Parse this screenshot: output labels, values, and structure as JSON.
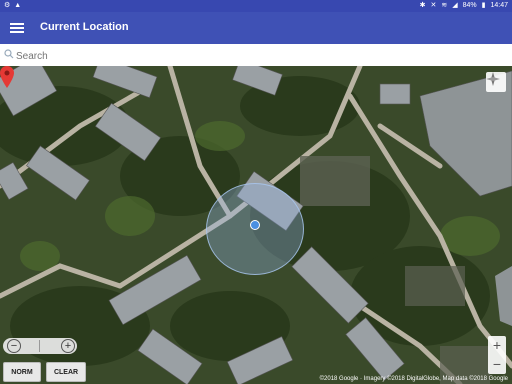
{
  "status": {
    "battery": "84%",
    "time": "14:47"
  },
  "appbar": {
    "title": "Current Location"
  },
  "search": {
    "placeholder": "Search"
  },
  "map": {
    "buttons": {
      "norm": "NORM",
      "clear": "CLEAR"
    },
    "zoom_in": "+",
    "zoom_out": "−",
    "copyright": "©2018 Google · Imagery ©2018 DigitalGlobe, Map data ©2018 Google"
  },
  "colors": {
    "appbar": "#3f51b5",
    "statusbar": "#3848b0",
    "pin": "#e53935",
    "location_dot": "#4a90e2"
  }
}
